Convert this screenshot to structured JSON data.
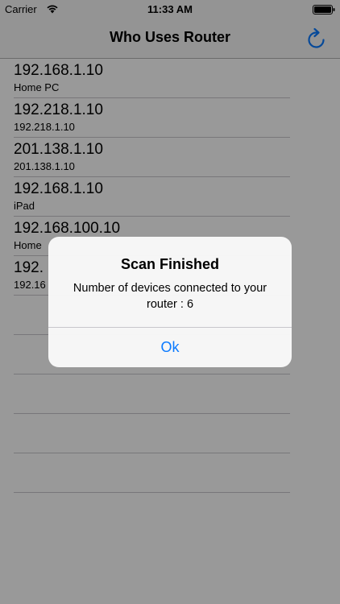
{
  "status_bar": {
    "carrier": "Carrier",
    "time": "11:33 AM",
    "wifi_icon": "wifi-icon",
    "battery_icon": "battery-icon"
  },
  "nav": {
    "title": "Who Uses Router",
    "refresh_icon": "refresh-icon"
  },
  "devices": [
    {
      "ip": "192.168.1.10",
      "name": "Home PC"
    },
    {
      "ip": "192.218.1.10",
      "name": "192.218.1.10"
    },
    {
      "ip": "201.138.1.10",
      "name": "201.138.1.10"
    },
    {
      "ip": "192.168.1.10",
      "name": "iPad"
    },
    {
      "ip": "192.168.100.10",
      "name": "Home "
    },
    {
      "ip": "192.",
      "name": "192.16"
    },
    {
      "ip": "",
      "name": ""
    },
    {
      "ip": "",
      "name": ""
    },
    {
      "ip": "",
      "name": ""
    },
    {
      "ip": "",
      "name": ""
    },
    {
      "ip": "",
      "name": ""
    }
  ],
  "alert": {
    "title": "Scan Finished",
    "message": "Number of devices connected to your router : 6",
    "ok_label": "Ok"
  },
  "colors": {
    "accent": "#0a7aff",
    "bar_background": "#f7f7f7",
    "overlay": "rgba(0,0,0,0.40)"
  }
}
